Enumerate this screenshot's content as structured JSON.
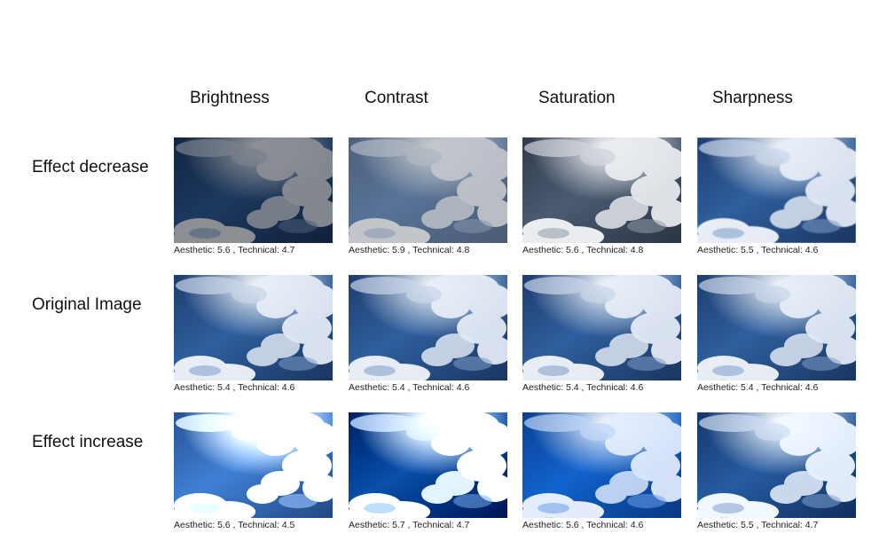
{
  "columns": [
    "Brightness",
    "Contrast",
    "Saturation",
    "Sharpness"
  ],
  "rows": [
    {
      "label": "Effect decrease",
      "captions": [
        "Aesthetic: 5.6 , Technical: 4.7",
        "Aesthetic: 5.9 , Technical: 4.8",
        "Aesthetic: 5.6 , Technical: 4.8",
        "Aesthetic: 5.5 , Technical: 4.6"
      ]
    },
    {
      "label": "Original Image",
      "captions": [
        "Aesthetic: 5.4 , Technical: 4.6",
        "Aesthetic: 5.4 , Technical: 4.6",
        "Aesthetic: 5.4 , Technical: 4.6",
        "Aesthetic: 5.4 , Technical: 4.6"
      ]
    },
    {
      "label": "Effect increase",
      "captions": [
        "Aesthetic: 5.6 , Technical: 4.5",
        "Aesthetic: 5.7 , Technical: 4.7",
        "Aesthetic: 5.6 , Technical: 4.6",
        "Aesthetic: 5.5 , Technical: 4.7"
      ]
    }
  ]
}
